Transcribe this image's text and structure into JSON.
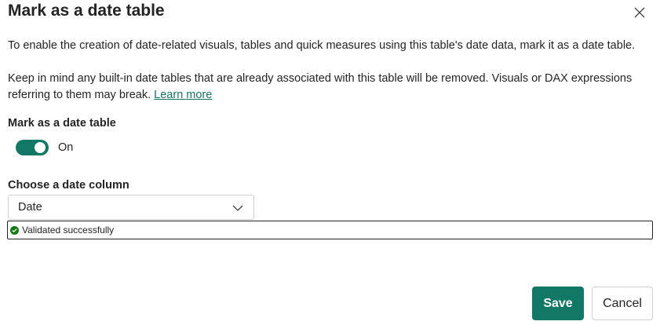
{
  "dialog": {
    "title": "Mark as a date table",
    "close_icon": "close-icon",
    "description_1": "To enable the creation of date-related visuals, tables and quick measures using this table's date data, mark it as a date table.",
    "description_2": "Keep in mind any built-in date tables that are already associated with this table will be removed. Visuals or DAX expressions referring to them may break.",
    "learn_more": "Learn more"
  },
  "toggle": {
    "label": "Mark as a date table",
    "state_text": "On",
    "checked": true
  },
  "date_column": {
    "label": "Choose a date column",
    "selected": "Date",
    "validation_message": "Validated successfully"
  },
  "buttons": {
    "save": "Save",
    "cancel": "Cancel"
  },
  "colors": {
    "accent": "#117865",
    "success": "#107c10",
    "text": "#242424"
  }
}
